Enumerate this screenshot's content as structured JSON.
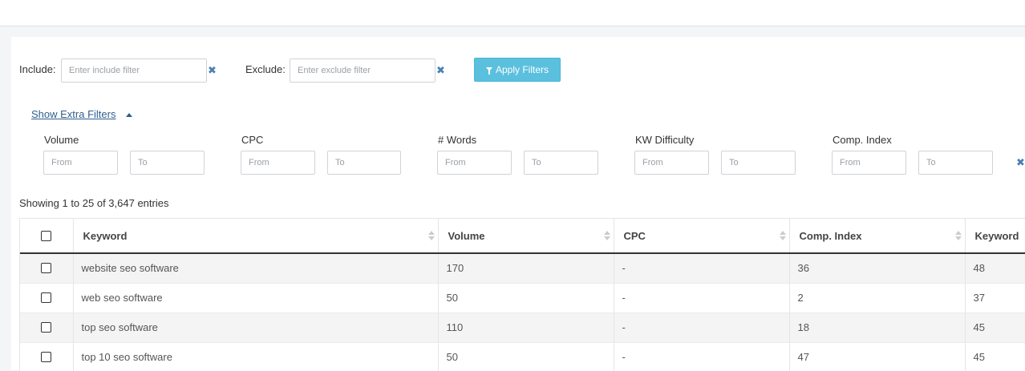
{
  "filters": {
    "include_label": "Include:",
    "include_placeholder": "Enter include filter",
    "exclude_label": "Exclude:",
    "exclude_placeholder": "Enter exclude filter",
    "apply_label": "Apply Filters",
    "extra_link": "Show Extra Filters",
    "ranges": [
      {
        "label": "Volume",
        "from": "From",
        "to": "To"
      },
      {
        "label": "CPC",
        "from": "From",
        "to": "To"
      },
      {
        "label": "# Words",
        "from": "From",
        "to": "To"
      },
      {
        "label": "KW Difficulty",
        "from": "From",
        "to": "To"
      },
      {
        "label": "Comp. Index",
        "from": "From",
        "to": "To"
      }
    ]
  },
  "table": {
    "showing": "Showing 1 to 25 of 3,647 entries",
    "columns": [
      "Keyword",
      "Volume",
      "CPC",
      "Comp. Index",
      "Keyword"
    ],
    "rows": [
      [
        "website seo software",
        "170",
        "-",
        "36",
        "48"
      ],
      [
        "web seo software",
        "50",
        "-",
        "2",
        "37"
      ],
      [
        "top seo software",
        "110",
        "-",
        "18",
        "45"
      ],
      [
        "top 10 seo software",
        "50",
        "-",
        "47",
        "45"
      ]
    ]
  },
  "icons": {
    "clear": "✖",
    "filter": "funnel-icon",
    "caret": "caret-up-icon",
    "sort": "sort-icon"
  },
  "colors": {
    "apply_button": "#5bc0de",
    "link": "#2e5e8e",
    "clear_icon": "#4a7fb5"
  }
}
